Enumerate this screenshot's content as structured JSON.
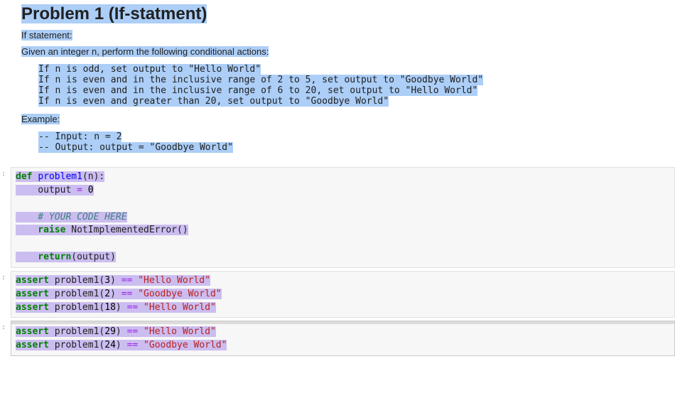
{
  "markdown": {
    "heading": "Problem 1 (If-statment)",
    "p1": "If statement:",
    "p2": "Given an integer n, perform the following conditional actions:",
    "cond1": "If n is odd, set output to \"Hello World\"",
    "cond2": "If n is even and in the inclusive range of 2 to 5, set output to \"Goodbye World\"",
    "cond3": "If n is even and in the inclusive range of 6 to 20, set output to \"Hello World\"",
    "cond4": "If n is even and greater than 20, set output to \"Goodbye World\"",
    "example_label": "Example:",
    "ex1": "-- Input: n = 2",
    "ex2": "-- Output: output = \"Goodbye World\""
  },
  "code1": {
    "def": "def",
    "fname": "problem1",
    "param_open": "(n):",
    "line2a": "    output ",
    "eq": "=",
    "line2b": " ",
    "zero": "0",
    "blank1": "",
    "comment": "    # YOUR CODE HERE",
    "raise": "    raise",
    "err": " NotImplementedError()",
    "blank2": "",
    "ret": "    return",
    "ret_tail": "(output)"
  },
  "code2": {
    "l1a": "assert",
    "l1b": " problem1(",
    "l1n": "3",
    "l1c": ") ",
    "l1op": "==",
    "l1d": " ",
    "l1s": "\"Hello World\"",
    "l2a": "assert",
    "l2b": " problem1(",
    "l2n": "2",
    "l2c": ") ",
    "l2op": "==",
    "l2d": " ",
    "l2s": "\"Goodbye World\"",
    "l3a": "assert",
    "l3b": " problem1(",
    "l3n": "18",
    "l3c": ") ",
    "l3op": "==",
    "l3d": " ",
    "l3s": "\"Hello World\""
  },
  "code3": {
    "l1a": "assert",
    "l1b": " problem1(",
    "l1n": "29",
    "l1c": ") ",
    "l1op": "==",
    "l1d": " ",
    "l1s": "\"Hello World\"",
    "l2a": "assert",
    "l2b": " problem1(",
    "l2n": "24",
    "l2c": ") ",
    "l2op": "==",
    "l2d": " ",
    "l2s": "\"Goodbye World\""
  },
  "prompts": {
    "code_indicator": ":"
  }
}
